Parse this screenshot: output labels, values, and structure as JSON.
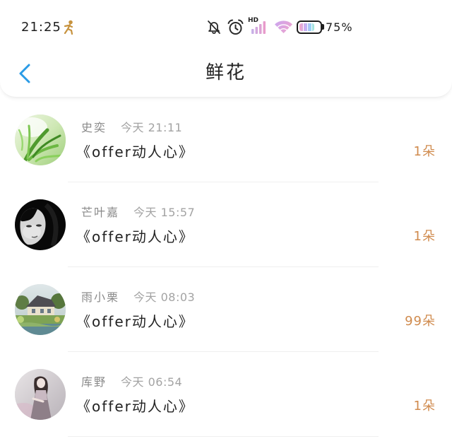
{
  "status_bar": {
    "time": "21:25",
    "network_label": "HD",
    "battery_text": "75%",
    "battery_level": 0.75,
    "icons": {
      "activity": "running-figure-icon",
      "mute": "bell-off-icon",
      "alarm": "alarm-clock-icon",
      "signal": "signal-bars-icon",
      "wifi": "wifi-icon",
      "battery": "battery-icon"
    }
  },
  "header": {
    "title": "鲜花",
    "back_icon": "chevron-left-icon"
  },
  "list": {
    "items": [
      {
        "name": "史奕",
        "time": "今天 21:11",
        "title": "《offer动人心》",
        "count": "1朵"
      },
      {
        "name": "芒叶嘉",
        "time": "今天 15:57",
        "title": "《offer动人心》",
        "count": "1朵"
      },
      {
        "name": "雨小栗",
        "time": "今天 08:03",
        "title": "《offer动人心》",
        "count": "99朵"
      },
      {
        "name": "库野",
        "time": "今天 06:54",
        "title": "《offer动人心》",
        "count": "1朵"
      }
    ]
  },
  "colors": {
    "accent": "#2a9be6",
    "count": "#d08b4e",
    "text_primary": "#222222",
    "text_secondary": "#8a8a8a",
    "text_muted": "#a3a3a3"
  }
}
